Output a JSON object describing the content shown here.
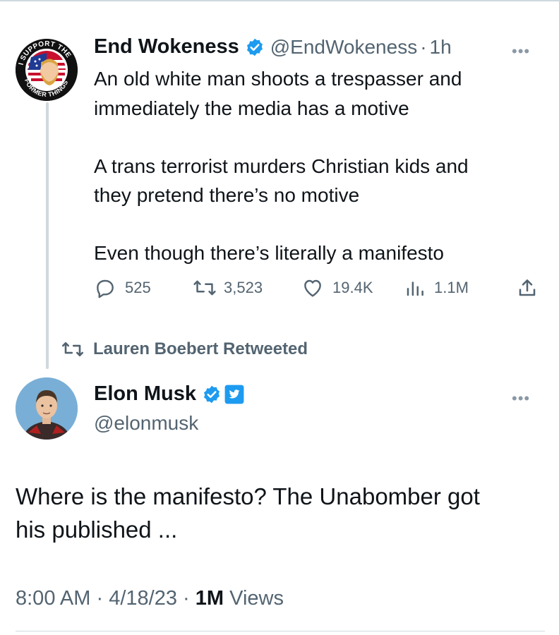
{
  "tweet1": {
    "display_name": "End Wokeness",
    "handle": "@EndWokeness",
    "separator": "·",
    "time": "1h",
    "lines": [
      "An old white man shoots a trespasser and",
      "immediately the media has a motive",
      "A trans terrorist murders Christian kids and",
      "they pretend there’s no motive",
      "Even though there’s literally a manifesto"
    ],
    "avatar_badge_top": "I SUPPORT THE",
    "avatar_badge_bottom": "FORMER THINGS",
    "stats": {
      "replies": "525",
      "retweets": "3,523",
      "likes": "19.4K",
      "views": "1.1M"
    }
  },
  "retweet_banner": "Lauren Boebert Retweeted",
  "tweet2": {
    "display_name": "Elon Musk",
    "handle": "@elonmusk",
    "lines": [
      "Where is the manifesto? The Unabomber got",
      "his published ..."
    ],
    "time": "8:00 AM",
    "dot1": "·",
    "date": "4/18/23",
    "dot2": "·",
    "views_count": "1M",
    "views_label": "Views"
  },
  "more_glyph": "•••",
  "colors": {
    "verified_blue": "#1d9bf0",
    "secondary_text": "#536471",
    "primary_text": "#0f1419",
    "divider": "#cfd9de"
  },
  "icons": [
    "verified-badge-icon",
    "twitter-logo-icon",
    "reply-icon",
    "retweet-icon",
    "like-icon",
    "views-icon",
    "share-icon",
    "more-icon"
  ]
}
